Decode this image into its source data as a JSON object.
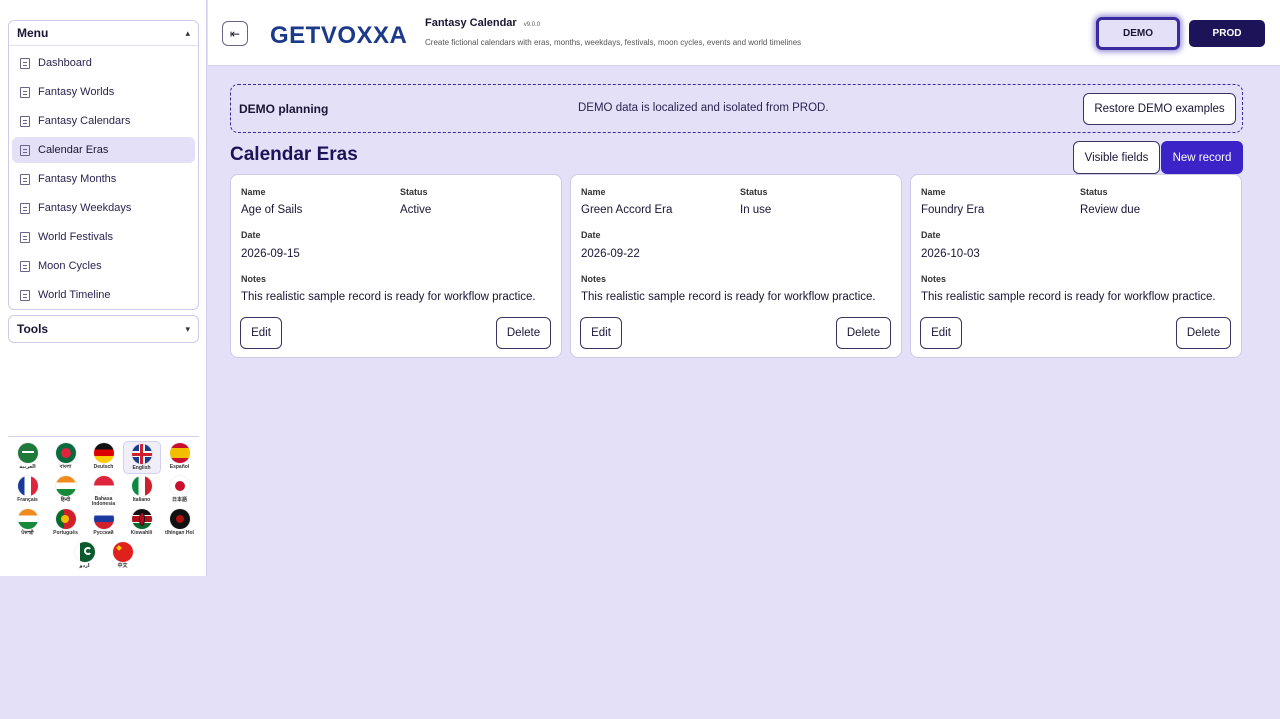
{
  "sidebar": {
    "menu_title": "Menu",
    "items": [
      {
        "label": "Dashboard"
      },
      {
        "label": "Fantasy Worlds"
      },
      {
        "label": "Fantasy Calendars"
      },
      {
        "label": "Calendar Eras"
      },
      {
        "label": "Fantasy Months"
      },
      {
        "label": "Fantasy Weekdays"
      },
      {
        "label": "World Festivals"
      },
      {
        "label": "Moon Cycles"
      },
      {
        "label": "World Timeline"
      }
    ],
    "active_item": "Calendar Eras",
    "tools_title": "Tools",
    "languages": [
      {
        "label": "العربية"
      },
      {
        "label": "বাংলা"
      },
      {
        "label": "Deutsch"
      },
      {
        "label": "English"
      },
      {
        "label": "Español"
      },
      {
        "label": "Français"
      },
      {
        "label": "हिन्दी"
      },
      {
        "label": "Bahasa Indonesia"
      },
      {
        "label": "Italiano"
      },
      {
        "label": "日本語"
      },
      {
        "label": "ਪੰਜਾਬੀ"
      },
      {
        "label": "Português"
      },
      {
        "label": "Русский"
      },
      {
        "label": "Kiswahili"
      },
      {
        "label": "tlhIngan Hol"
      },
      {
        "label": "اردو"
      },
      {
        "label": "中文"
      }
    ],
    "selected_language": "English"
  },
  "header": {
    "logo_text": "GETVOXXA",
    "app_title": "Fantasy Calendar",
    "version": "v9.0.0",
    "description": "Create fictional calendars with eras, months, weekdays, festivals, moon cycles, events and world timelines",
    "env_demo": "DEMO",
    "env_prod": "PROD"
  },
  "notice": {
    "title": "DEMO planning",
    "message": "DEMO data is localized and isolated from PROD.",
    "restore_label": "Restore DEMO examples"
  },
  "main": {
    "title": "Calendar Eras",
    "visible_fields_label": "Visible fields",
    "new_record_label": "New record",
    "labels": {
      "name": "Name",
      "status": "Status",
      "date": "Date",
      "notes": "Notes",
      "edit": "Edit",
      "delete": "Delete"
    },
    "cards": [
      {
        "name": "Age of Sails",
        "status": "Active",
        "date": "2026-09-15",
        "notes": "This realistic sample record is ready for workflow practice."
      },
      {
        "name": "Green Accord Era",
        "status": "In use",
        "date": "2026-09-22",
        "notes": "This realistic sample record is ready for workflow practice."
      },
      {
        "name": "Foundry Era",
        "status": "Review due",
        "date": "2026-10-03",
        "notes": "This realistic sample record is ready for workflow practice."
      }
    ]
  },
  "colors": {
    "accent": "#3b23c7",
    "prod": "#1c1358",
    "background": "#e4e0f8"
  }
}
